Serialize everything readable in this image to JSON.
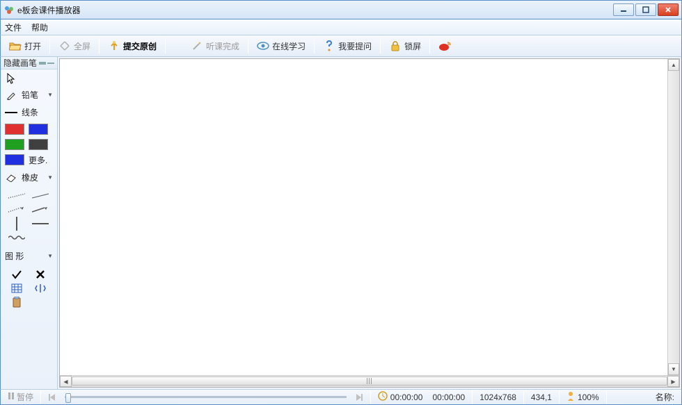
{
  "window": {
    "title": "e板会课件播放器"
  },
  "menubar": {
    "file": "文件",
    "help": "帮助"
  },
  "toolbar": {
    "open": "打开",
    "fullscreen": "全屏",
    "submit_original": "提交原创",
    "lesson_done": "听课完成",
    "online_learning": "在线学习",
    "ask_question": "我要提问",
    "lock_screen": "锁屏"
  },
  "sidebar": {
    "header": "隐藏画笔",
    "pencil": "铅笔",
    "line": "线条",
    "more": "更多.",
    "eraser": "橡皮",
    "shapes": "图 形",
    "colors": {
      "red": "#e03030",
      "blue": "#2030e0",
      "green": "#20a020",
      "black": "#404040",
      "blue2": "#2030e0"
    }
  },
  "status": {
    "pause": "暂停",
    "current_time": "00:00:00",
    "total_time": "00:00:00",
    "resolution": "1024x768",
    "coords": "434,1",
    "zoom": "100%",
    "name_label": "名称:"
  }
}
